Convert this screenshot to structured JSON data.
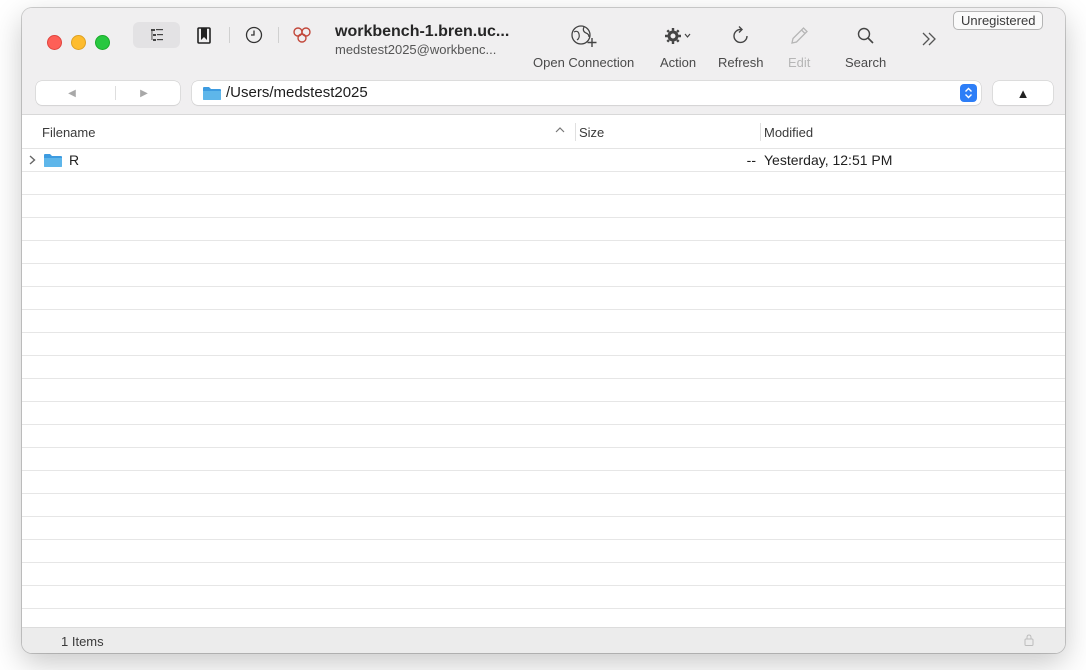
{
  "window": {
    "title": "workbench-1.bren.uc...",
    "subtitle": "medstest2025@workbenc...",
    "unregistered_label": "Unregistered"
  },
  "toolbar": {
    "icons": [
      "outline-view-icon",
      "bookmark-icon",
      "history-icon",
      "bonjour-icon"
    ],
    "open_connection_label": "Open Connection",
    "action_label": "Action",
    "refresh_label": "Refresh",
    "edit_label": "Edit",
    "search_label": "Search",
    "more_icon": "chevron-double-right-icon"
  },
  "navigation": {
    "back_glyph": "◀",
    "forward_glyph": "▶",
    "path": "/Users/medstest2025",
    "up_glyph": "▲"
  },
  "columns": {
    "filename": "Filename",
    "size": "Size",
    "modified": "Modified",
    "sort_glyph": "^"
  },
  "files": [
    {
      "name": "R",
      "size": "--",
      "modified": "Yesterday, 12:51 PM",
      "type": "folder"
    }
  ],
  "status": {
    "text": "1 Items"
  },
  "colors": {
    "accent": "#2d7ef7",
    "folder": "#5eb6ea",
    "titlebar": "#f0eff0"
  }
}
